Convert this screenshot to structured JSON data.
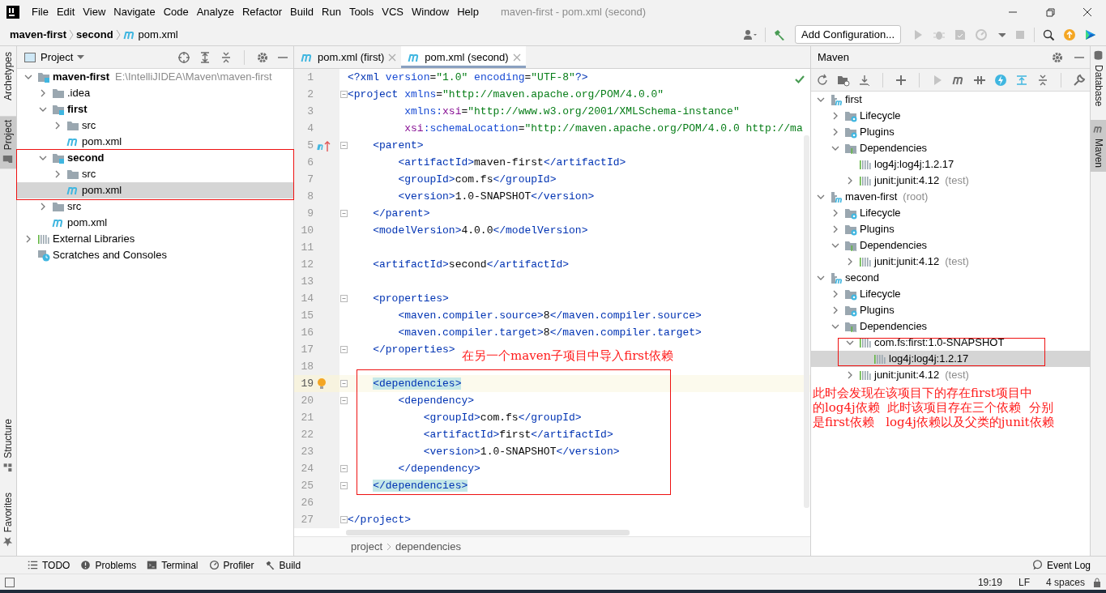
{
  "menu_bar": {
    "items": [
      "File",
      "Edit",
      "View",
      "Navigate",
      "Code",
      "Analyze",
      "Refactor",
      "Build",
      "Run",
      "Tools",
      "VCS",
      "Window",
      "Help"
    ],
    "title": "maven-first - pom.xml (second)"
  },
  "navigation_bar": {
    "breadcrumb": [
      {
        "label": "maven-first",
        "kind": "module"
      },
      {
        "label": "second",
        "kind": "module"
      },
      {
        "label": "pom.xml",
        "kind": "maven-file"
      }
    ],
    "run_configuration": "Add Configuration..."
  },
  "left_stripe": {
    "top": [
      {
        "label": "Archetypes",
        "selected": false
      },
      {
        "label": "Project",
        "selected": true
      }
    ],
    "bottom": [
      {
        "label": "Structure",
        "selected": false
      },
      {
        "label": "Favorites",
        "selected": false
      }
    ]
  },
  "project_panel": {
    "title": "Project",
    "tree": [
      {
        "label": "maven-first",
        "hint": "E:\\IntelliJIDEA\\Maven\\maven-first",
        "kind": "module",
        "expanded": true,
        "selected": false,
        "children": [
          {
            "label": ".idea",
            "kind": "folder",
            "expanded": false,
            "selected": false
          },
          {
            "label": "first",
            "kind": "module",
            "expanded": true,
            "selected": false,
            "children": [
              {
                "label": "src",
                "kind": "folder",
                "expanded": false,
                "selected": false
              },
              {
                "label": "pom.xml",
                "kind": "maven-file",
                "selected": false
              }
            ]
          },
          {
            "label": "second",
            "kind": "module",
            "expanded": true,
            "selected": false,
            "children": [
              {
                "label": "src",
                "kind": "folder",
                "expanded": false,
                "selected": false
              },
              {
                "label": "pom.xml",
                "kind": "maven-file",
                "selected": true
              }
            ]
          },
          {
            "label": "src",
            "kind": "folder",
            "expanded": false,
            "selected": false
          },
          {
            "label": "pom.xml",
            "kind": "maven-file",
            "selected": false
          }
        ]
      },
      {
        "label": "External Libraries",
        "kind": "library",
        "expanded": false,
        "selected": false
      },
      {
        "label": "Scratches and Consoles",
        "kind": "scratch",
        "selected": false
      }
    ]
  },
  "editor": {
    "tabs": [
      {
        "label": "pom.xml (first)",
        "selected": false
      },
      {
        "label": "pom.xml (second)",
        "selected": true
      }
    ],
    "lines": [
      {
        "n": "1",
        "current": false,
        "fold": false,
        "segs": [
          {
            "kind": "tag",
            "t": "<?xml"
          },
          {
            "kind": "attr",
            "t": " version"
          },
          {
            "kind": "p",
            "t": "="
          },
          {
            "kind": "str",
            "t": "\"1.0\""
          },
          {
            "kind": "attr",
            "t": " encoding"
          },
          {
            "kind": "p",
            "t": "="
          },
          {
            "kind": "str",
            "t": "\"UTF-8\""
          },
          {
            "kind": "tag",
            "t": "?>"
          }
        ]
      },
      {
        "n": "2",
        "current": false,
        "fold": true,
        "segs": [
          {
            "kind": "tag",
            "t": "<project"
          },
          {
            "kind": "attr",
            "t": " xmlns"
          },
          {
            "kind": "p",
            "t": "="
          },
          {
            "kind": "str",
            "t": "\"http://maven.apache.org/POM/4.0.0\""
          }
        ]
      },
      {
        "n": "3",
        "current": false,
        "fold": false,
        "segs": [
          {
            "kind": "attr",
            "t": "         xmlns:"
          },
          {
            "kind": "ns",
            "t": "xsi"
          },
          {
            "kind": "p",
            "t": "="
          },
          {
            "kind": "str",
            "t": "\"http://www.w3.org/2001/XMLSchema-instance\""
          }
        ]
      },
      {
        "n": "4",
        "current": false,
        "fold": false,
        "segs": [
          {
            "kind": "ns",
            "t": "         xsi"
          },
          {
            "kind": "attr",
            "t": ":schemaLocation"
          },
          {
            "kind": "p",
            "t": "="
          },
          {
            "kind": "str",
            "t": "\"http://maven.apache.org/POM/4.0.0 http://ma"
          }
        ]
      },
      {
        "n": "5",
        "current": false,
        "fold": true,
        "kind": "maven-parent",
        "segs": [
          {
            "kind": "tag",
            "t": "    <parent>"
          }
        ]
      },
      {
        "n": "6",
        "current": false,
        "fold": false,
        "segs": [
          {
            "kind": "tag",
            "t": "        <artifactId>"
          },
          {
            "kind": "p",
            "t": "maven-first"
          },
          {
            "kind": "tag",
            "t": "</artifactId>"
          }
        ]
      },
      {
        "n": "7",
        "current": false,
        "fold": false,
        "segs": [
          {
            "kind": "tag",
            "t": "        <groupId>"
          },
          {
            "kind": "p",
            "t": "com.fs"
          },
          {
            "kind": "tag",
            "t": "</groupId>"
          }
        ]
      },
      {
        "n": "8",
        "current": false,
        "fold": false,
        "segs": [
          {
            "kind": "tag",
            "t": "        <version>"
          },
          {
            "kind": "p",
            "t": "1.0-SNAPSHOT"
          },
          {
            "kind": "tag",
            "t": "</version>"
          }
        ]
      },
      {
        "n": "9",
        "current": false,
        "fold": true,
        "segs": [
          {
            "kind": "tag",
            "t": "    </parent>"
          }
        ]
      },
      {
        "n": "10",
        "current": false,
        "fold": false,
        "segs": [
          {
            "kind": "tag",
            "t": "    <modelVersion>"
          },
          {
            "kind": "p",
            "t": "4.0.0"
          },
          {
            "kind": "tag",
            "t": "</modelVersion>"
          }
        ]
      },
      {
        "n": "11",
        "current": false,
        "fold": false
      },
      {
        "n": "12",
        "current": false,
        "fold": false,
        "segs": [
          {
            "kind": "tag",
            "t": "    <artifactId>"
          },
          {
            "kind": "p",
            "t": "second"
          },
          {
            "kind": "tag",
            "t": "</artifactId>"
          }
        ]
      },
      {
        "n": "13",
        "current": false,
        "fold": false
      },
      {
        "n": "14",
        "current": false,
        "fold": true,
        "segs": [
          {
            "kind": "tag",
            "t": "    <properties>"
          }
        ]
      },
      {
        "n": "15",
        "current": false,
        "fold": false,
        "segs": [
          {
            "kind": "tag",
            "t": "        <maven.compiler.source>"
          },
          {
            "kind": "p",
            "t": "8"
          },
          {
            "kind": "tag",
            "t": "</maven.compiler.source>"
          }
        ]
      },
      {
        "n": "16",
        "current": false,
        "fold": false,
        "segs": [
          {
            "kind": "tag",
            "t": "        <maven.compiler.target>"
          },
          {
            "kind": "p",
            "t": "8"
          },
          {
            "kind": "tag",
            "t": "</maven.compiler.target>"
          }
        ]
      },
      {
        "n": "17",
        "current": false,
        "fold": true,
        "segs": [
          {
            "kind": "tag",
            "t": "    </properties>"
          }
        ]
      },
      {
        "n": "18",
        "current": false,
        "fold": false
      },
      {
        "n": "19",
        "current": true,
        "fold": true,
        "kind": "bulb",
        "segs": [
          {
            "kind": "tag",
            "t": "    <dependencies>",
            "matched": true
          }
        ]
      },
      {
        "n": "20",
        "current": false,
        "fold": true,
        "segs": [
          {
            "kind": "tag",
            "t": "        <dependency>"
          }
        ]
      },
      {
        "n": "21",
        "current": false,
        "fold": false,
        "segs": [
          {
            "kind": "tag",
            "t": "            <groupId>"
          },
          {
            "kind": "p",
            "t": "com.fs"
          },
          {
            "kind": "tag",
            "t": "</groupId>"
          }
        ]
      },
      {
        "n": "22",
        "current": false,
        "fold": false,
        "segs": [
          {
            "kind": "tag",
            "t": "            <artifactId>"
          },
          {
            "kind": "p",
            "t": "first"
          },
          {
            "kind": "tag",
            "t": "</artifactId>"
          }
        ]
      },
      {
        "n": "23",
        "current": false,
        "fold": false,
        "segs": [
          {
            "kind": "tag",
            "t": "            <version>"
          },
          {
            "kind": "p",
            "t": "1.0-SNAPSHOT"
          },
          {
            "kind": "tag",
            "t": "</version>"
          }
        ]
      },
      {
        "n": "24",
        "current": false,
        "fold": true,
        "segs": [
          {
            "kind": "tag",
            "t": "        </dependency>"
          }
        ]
      },
      {
        "n": "25",
        "current": false,
        "fold": true,
        "segs": [
          {
            "kind": "tag",
            "t": "    </dependencies>",
            "matched": true
          }
        ]
      },
      {
        "n": "26",
        "current": false,
        "fold": false
      },
      {
        "n": "27",
        "current": false,
        "fold": true,
        "segs": [
          {
            "kind": "tag",
            "t": "</project>"
          }
        ]
      }
    ],
    "breadcrumb": [
      "project",
      "dependencies"
    ]
  },
  "maven_panel": {
    "title": "Maven",
    "tree": [
      {
        "label": "first",
        "kind": "project",
        "expanded": true,
        "selected": false,
        "children": [
          {
            "label": "Lifecycle",
            "kind": "lifecycle",
            "expanded": false,
            "selected": false
          },
          {
            "label": "Plugins",
            "kind": "plugins",
            "expanded": false,
            "selected": false
          },
          {
            "label": "Dependencies",
            "kind": "dependencies",
            "expanded": true,
            "selected": false,
            "children": [
              {
                "label": "log4j:log4j:1.2.17",
                "kind": "artifact",
                "selected": false
              },
              {
                "label": "junit:junit:4.12",
                "hint": "(test)",
                "kind": "artifact",
                "expanded": false,
                "selected": false
              }
            ]
          }
        ]
      },
      {
        "label": "maven-first",
        "hint": "(root)",
        "kind": "project",
        "expanded": true,
        "selected": false,
        "children": [
          {
            "label": "Lifecycle",
            "kind": "lifecycle",
            "expanded": false,
            "selected": false
          },
          {
            "label": "Plugins",
            "kind": "plugins",
            "expanded": false,
            "selected": false
          },
          {
            "label": "Dependencies",
            "kind": "dependencies",
            "expanded": true,
            "selected": false,
            "children": [
              {
                "label": "junit:junit:4.12",
                "hint": "(test)",
                "kind": "artifact",
                "expanded": false,
                "selected": false
              }
            ]
          }
        ]
      },
      {
        "label": "second",
        "kind": "project",
        "expanded": true,
        "selected": false,
        "children": [
          {
            "label": "Lifecycle",
            "kind": "lifecycle",
            "expanded": false,
            "selected": false
          },
          {
            "label": "Plugins",
            "kind": "plugins",
            "expanded": false,
            "selected": false
          },
          {
            "label": "Dependencies",
            "kind": "dependencies",
            "expanded": true,
            "selected": false,
            "children": [
              {
                "label": "com.fs:first:1.0-SNAPSHOT",
                "kind": "artifact",
                "expanded": true,
                "selected": false,
                "children": [
                  {
                    "label": "log4j:log4j:1.2.17",
                    "kind": "artifact",
                    "selected": true
                  }
                ]
              },
              {
                "label": "junit:junit:4.12",
                "hint": "(test)",
                "kind": "artifact",
                "expanded": false,
                "selected": false
              }
            ]
          }
        ]
      }
    ]
  },
  "right_stripe": [
    {
      "label": "Database",
      "selected": false
    },
    {
      "label": "Maven",
      "selected": true
    }
  ],
  "annotations": {
    "editor_note": "在另一个maven子项目中导入first依赖",
    "maven_note": [
      "此时会发现在该项目下的存在first项目中",
      "的log4j依赖  此时该项目存在三个依赖  分别",
      "是first依赖   log4j依赖以及父类的junit依赖"
    ]
  },
  "tool_strip": {
    "tools": [
      "TODO",
      "Problems",
      "Terminal",
      "Profiler",
      "Build"
    ],
    "event_log": "Event Log"
  },
  "status_bar": {
    "items": [
      "19:19",
      "LF",
      "4 spaces"
    ]
  }
}
